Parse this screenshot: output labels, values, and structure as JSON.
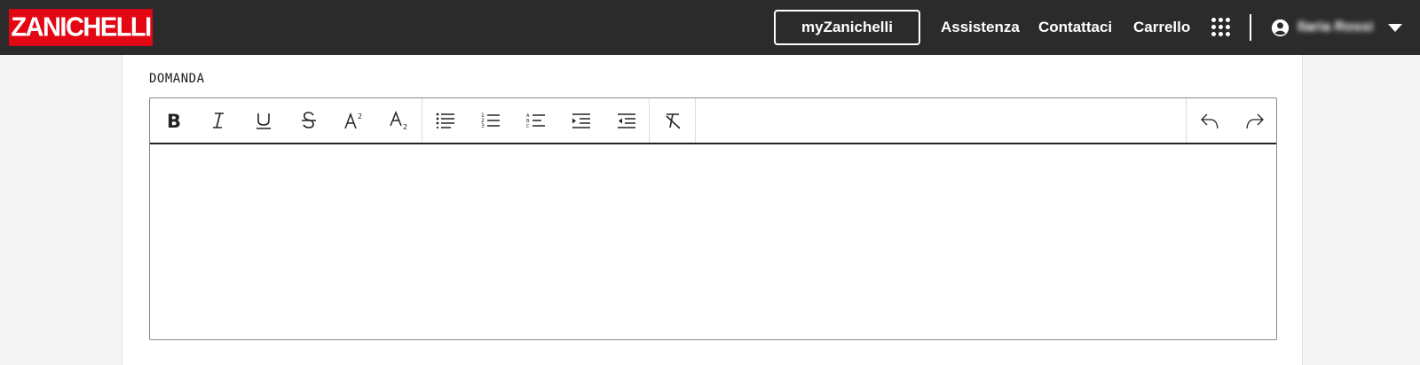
{
  "header": {
    "logo": "ZANICHELLI",
    "my_button": "myZanichelli",
    "nav": [
      "Assistenza",
      "Contattaci",
      "Carrello"
    ],
    "user_name": "Ilaria Rossi",
    "icons": [
      "apps-grid-icon",
      "user-circle-icon",
      "caret-down-icon"
    ],
    "colors": {
      "bar": "#2b2b2b",
      "brand": "#e30613"
    }
  },
  "form": {
    "field_label": "DOMANDA",
    "editor_value": ""
  },
  "toolbar": {
    "format": [
      "bold-icon",
      "italic-icon",
      "underline-icon",
      "strikethrough-icon",
      "superscript-icon",
      "subscript-icon"
    ],
    "lists": [
      "bulleted-list-icon",
      "numbered-list-icon",
      "lettered-list-icon",
      "indent-icon",
      "outdent-icon"
    ],
    "clear": [
      "clear-formatting-icon"
    ],
    "history": [
      "undo-icon",
      "redo-icon"
    ]
  }
}
